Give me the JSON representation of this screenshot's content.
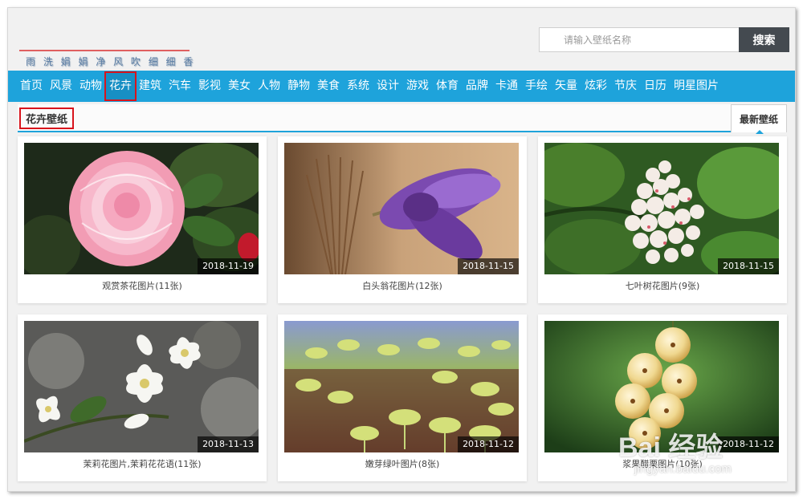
{
  "header": {
    "slogan": "雨 洗 娟 娟 净   风 吹 细 细 香",
    "search_placeholder": "请输入壁纸名称",
    "search_button": "搜索"
  },
  "nav": {
    "items": [
      "首页",
      "风景",
      "动物",
      "花卉",
      "建筑",
      "汽车",
      "影视",
      "美女",
      "人物",
      "静物",
      "美食",
      "系统",
      "设计",
      "游戏",
      "体育",
      "品牌",
      "卡通",
      "手绘",
      "矢量",
      "炫彩",
      "节庆",
      "日历",
      "明星图片"
    ],
    "active_index": 3
  },
  "section": {
    "title": "花卉壁纸",
    "tab": "最新壁纸"
  },
  "cards": [
    {
      "date": "2018-11-19",
      "caption": "观赏茶花图片(11张)",
      "image": "pink-camellia"
    },
    {
      "date": "2018-11-15",
      "caption": "白头翁花图片(12张)",
      "image": "purple-pasqueflower"
    },
    {
      "date": "2018-11-15",
      "caption": "七叶树花图片(9张)",
      "image": "white-horse-chestnut"
    },
    {
      "date": "2018-11-13",
      "caption": "茉莉花图片,茉莉花花语(11张)",
      "image": "white-jasmine"
    },
    {
      "date": "2018-11-12",
      "caption": "嫩芽绿叶图片(8张)",
      "image": "green-sprouts"
    },
    {
      "date": "2018-11-12",
      "caption": "浆果醋栗图片(10张)",
      "image": "currant-berries"
    }
  ],
  "watermark": {
    "brand": "Bai 经验",
    "url": "jingyan.baidu.com"
  },
  "colors": {
    "nav_bg": "#1ea3db",
    "highlight_border": "#d8141c",
    "search_button_bg": "#444a50"
  }
}
